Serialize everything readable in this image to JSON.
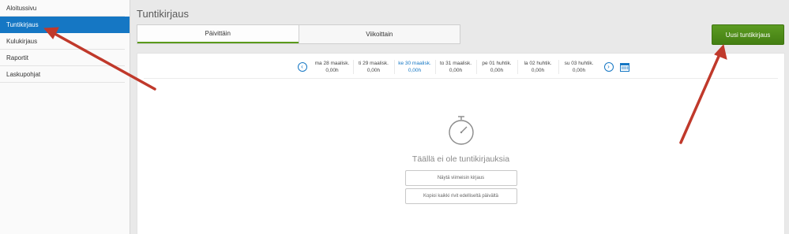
{
  "sidebar": {
    "items": [
      {
        "label": "Aloitussivu",
        "active": false
      },
      {
        "label": "Tuntikirjaus",
        "active": true
      },
      {
        "label": "Kulukirjaus",
        "active": false
      },
      {
        "label": "Raportit",
        "active": false
      },
      {
        "label": "Laskupohjat",
        "active": false
      }
    ]
  },
  "header": {
    "title": "Tuntikirjaus",
    "tabs": [
      {
        "label": "Päivittäin",
        "active": true
      },
      {
        "label": "Viikoittain",
        "active": false
      }
    ],
    "new_button_label": "Uusi tuntikirjaus"
  },
  "week": {
    "prev_icon": "chevron-left-icon",
    "next_icon": "chevron-right-icon",
    "calendar_icon": "calendar-icon",
    "days": [
      {
        "label": "ma 28 maalisk.",
        "hours": "0,00h"
      },
      {
        "label": "ti 29 maalisk.",
        "hours": "0,00h"
      },
      {
        "label": "ke 30 maalisk.",
        "hours": "0,00h",
        "current": true
      },
      {
        "label": "to 31 maalisk.",
        "hours": "0,00h"
      },
      {
        "label": "pe 01 huhtik.",
        "hours": "0,00h"
      },
      {
        "label": "la 02 huhtik.",
        "hours": "0,00h"
      },
      {
        "label": "su 03 huhtik.",
        "hours": "0,00h"
      }
    ]
  },
  "empty_state": {
    "icon": "stopwatch-icon",
    "message": "Täällä ei ole tuntikirjauksia",
    "show_latest_label": "Näytä viimeisin kirjaus",
    "copy_previous_label": "Kopioi kaikki rivit edelliseltä päivältä"
  },
  "colors": {
    "accent_blue": "#1577c4",
    "accent_green": "#4a8a18",
    "annotation_arrow": "#c0392b"
  }
}
